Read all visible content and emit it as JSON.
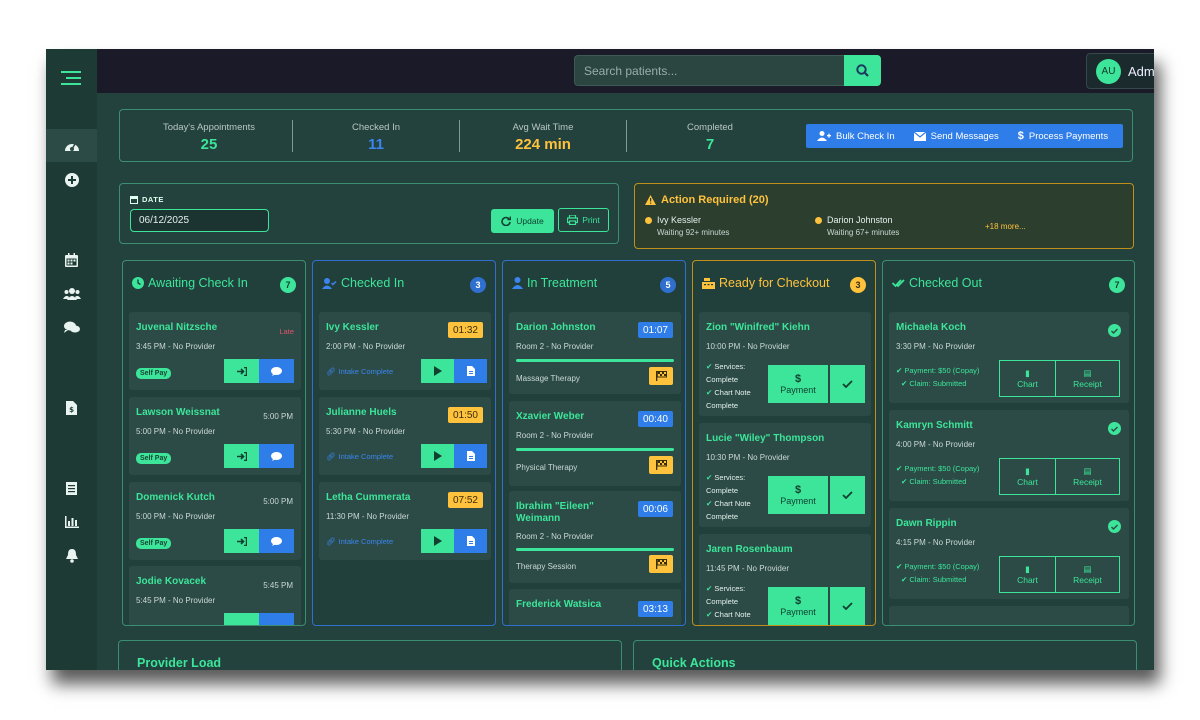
{
  "topbar": {
    "search_placeholder": "Search patients...",
    "user_initials": "AU",
    "user_name": "Admin"
  },
  "stats": [
    {
      "label": "Today's Appointments",
      "value": "25",
      "color": "#3ce59a"
    },
    {
      "label": "Checked In",
      "value": "11",
      "color": "#3a85f0"
    },
    {
      "label": "Avg Wait Time",
      "value": "224 min",
      "color": "#ffc23d"
    },
    {
      "label": "Completed",
      "value": "7",
      "color": "#3ce59a"
    }
  ],
  "actions": {
    "bulk_check_in": "Bulk Check In",
    "send_messages": "Send Messages",
    "process_payments": "Process Payments"
  },
  "date": {
    "label": "DATE",
    "value": "06/12/2025",
    "update": "Update",
    "print": "Print"
  },
  "action_required": {
    "title": "Action Required (20)",
    "items": [
      {
        "name": "Ivy Kessler",
        "sub": "Waiting 92+ minutes"
      },
      {
        "name": "Darion Johnston",
        "sub": "Waiting 67+ minutes"
      }
    ],
    "more": "+18 more..."
  },
  "columns": {
    "awaiting": {
      "title": "Awaiting Check In",
      "count": "7",
      "cards": [
        {
          "name": "Juvenal Nitzsche",
          "time": "3:45 PM - No Provider",
          "right": "Late",
          "badge": "Self Pay"
        },
        {
          "name": "Lawson Weissnat",
          "time": "5:00 PM - No Provider",
          "right": "5:00 PM",
          "badge": "Self Pay"
        },
        {
          "name": "Domenick Kutch",
          "time": "5:00 PM - No Provider",
          "right": "5:00 PM",
          "badge": "Self Pay"
        },
        {
          "name": "Jodie Kovacek",
          "time": "5:45 PM - No Provider",
          "right": "5:45 PM",
          "badge": ""
        }
      ]
    },
    "checked_in": {
      "title": "Checked In",
      "count": "3",
      "cards": [
        {
          "name": "Ivy Kessler",
          "time": "2:00 PM - No Provider",
          "timer": "01:32",
          "status": "Intake Complete"
        },
        {
          "name": "Julianne Huels",
          "time": "5:30 PM - No Provider",
          "timer": "01:50",
          "status": "Intake Complete"
        },
        {
          "name": "Letha Cummerata",
          "time": "11:30 PM - No Provider",
          "timer": "07:52",
          "status": "Intake Complete"
        }
      ]
    },
    "in_treatment": {
      "title": "In Treatment",
      "count": "5",
      "cards": [
        {
          "name": "Darion Johnston",
          "room": "Room 2 - No Provider",
          "timer": "01:07",
          "service": "Massage Therapy"
        },
        {
          "name": "Xzavier Weber",
          "room": "Room 2 - No Provider",
          "timer": "00:40",
          "service": "Physical Therapy"
        },
        {
          "name": "Ibrahim \"Eileen\" Weimann",
          "room": "Room 2 - No Provider",
          "timer": "00:06",
          "service": "Therapy Session"
        },
        {
          "name": "Frederick Watsica",
          "room": "",
          "timer": "03:13",
          "service": ""
        }
      ]
    },
    "ready_checkout": {
      "title": "Ready for Checkout",
      "count": "3",
      "cards": [
        {
          "name": "Zion \"Winifred\" Kiehn",
          "time": "10:00 PM - No Provider"
        },
        {
          "name": "Lucie \"Wiley\" Thompson",
          "time": "10:30 PM - No Provider"
        },
        {
          "name": "Jaren Rosenbaum",
          "time": "11:45 PM - No Provider"
        }
      ],
      "services_label": "Services:",
      "complete": "Complete",
      "chart_note_label": "Chart Note",
      "payment": "Payment",
      "dollar": "$"
    },
    "checked_out": {
      "title": "Checked Out",
      "count": "7",
      "cards": [
        {
          "name": "Michaela Koch",
          "time": "3:30 PM - No Provider"
        },
        {
          "name": "Kamryn Schmitt",
          "time": "4:00 PM - No Provider"
        },
        {
          "name": "Dawn Rippin",
          "time": "4:15 PM - No Provider"
        }
      ],
      "payment_text": "Payment: $50 (Copay)",
      "claim_text": "Claim: Submitted",
      "chart": "Chart",
      "receipt": "Receipt"
    }
  },
  "bottom": {
    "provider_load": "Provider Load",
    "quick_actions": "Quick Actions"
  },
  "colors": {
    "accent": "#3ce59a",
    "blue": "#3a85f0",
    "amber": "#ffc23d",
    "panel": "#23423d"
  }
}
